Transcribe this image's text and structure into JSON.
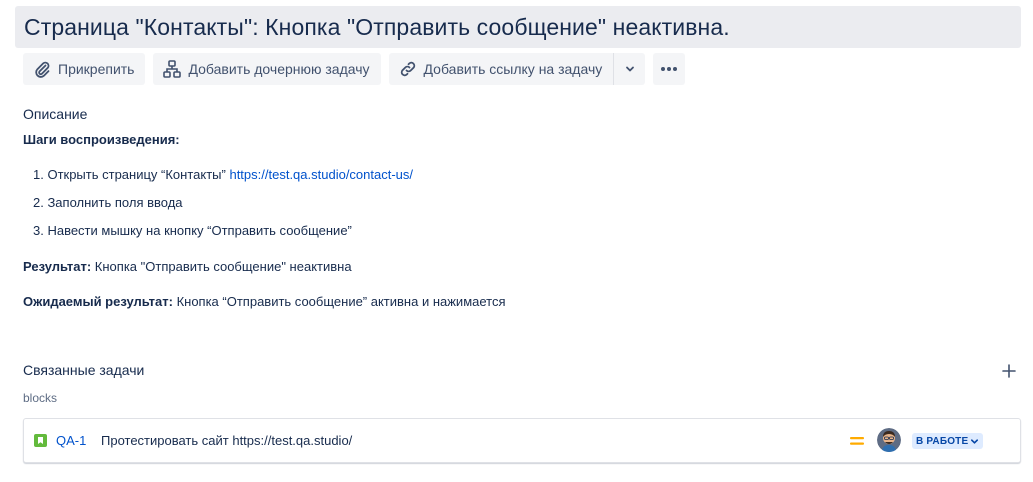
{
  "issue": {
    "title": "Страница \"Контакты\": Кнопка \"Отправить сообщение\" неактивна."
  },
  "toolbar": {
    "attach_label": "Прикрепить",
    "add_child_label": "Добавить дочернюю задачу",
    "add_link_label": "Добавить ссылку на задачу"
  },
  "description": {
    "heading": "Описание",
    "steps_title": "Шаги воспроизведения:",
    "steps": [
      {
        "text": "1. Открыть страницу “Контакты” ",
        "link": "https://test.qa.studio/contact-us/"
      },
      {
        "text": "2. Заполнить поля ввода"
      },
      {
        "text": "3. Навести мышку на кнопку “Отправить сообщение”"
      }
    ],
    "result_label": "Результат:",
    "result_text": " Кнопка \"Отправить сообщение\" неактивна",
    "expected_label": "Ожидаемый результат:",
    "expected_text": " Кнопка “Отправить сообщение” активна и нажимается"
  },
  "linked_issues": {
    "heading": "Связанные задачи",
    "relation": "blocks",
    "items": [
      {
        "key": "QA-1",
        "summary": "Протестировать сайт https://test.qa.studio/",
        "status": "В РАБОТЕ",
        "type_color": "#63ba3c",
        "priority": "medium",
        "priority_color": "#ffab00"
      }
    ]
  },
  "colors": {
    "accent": "#0052cc",
    "title_bg": "#ebecf0",
    "button_bg": "#f4f5f7",
    "status_bg": "#deebff"
  }
}
